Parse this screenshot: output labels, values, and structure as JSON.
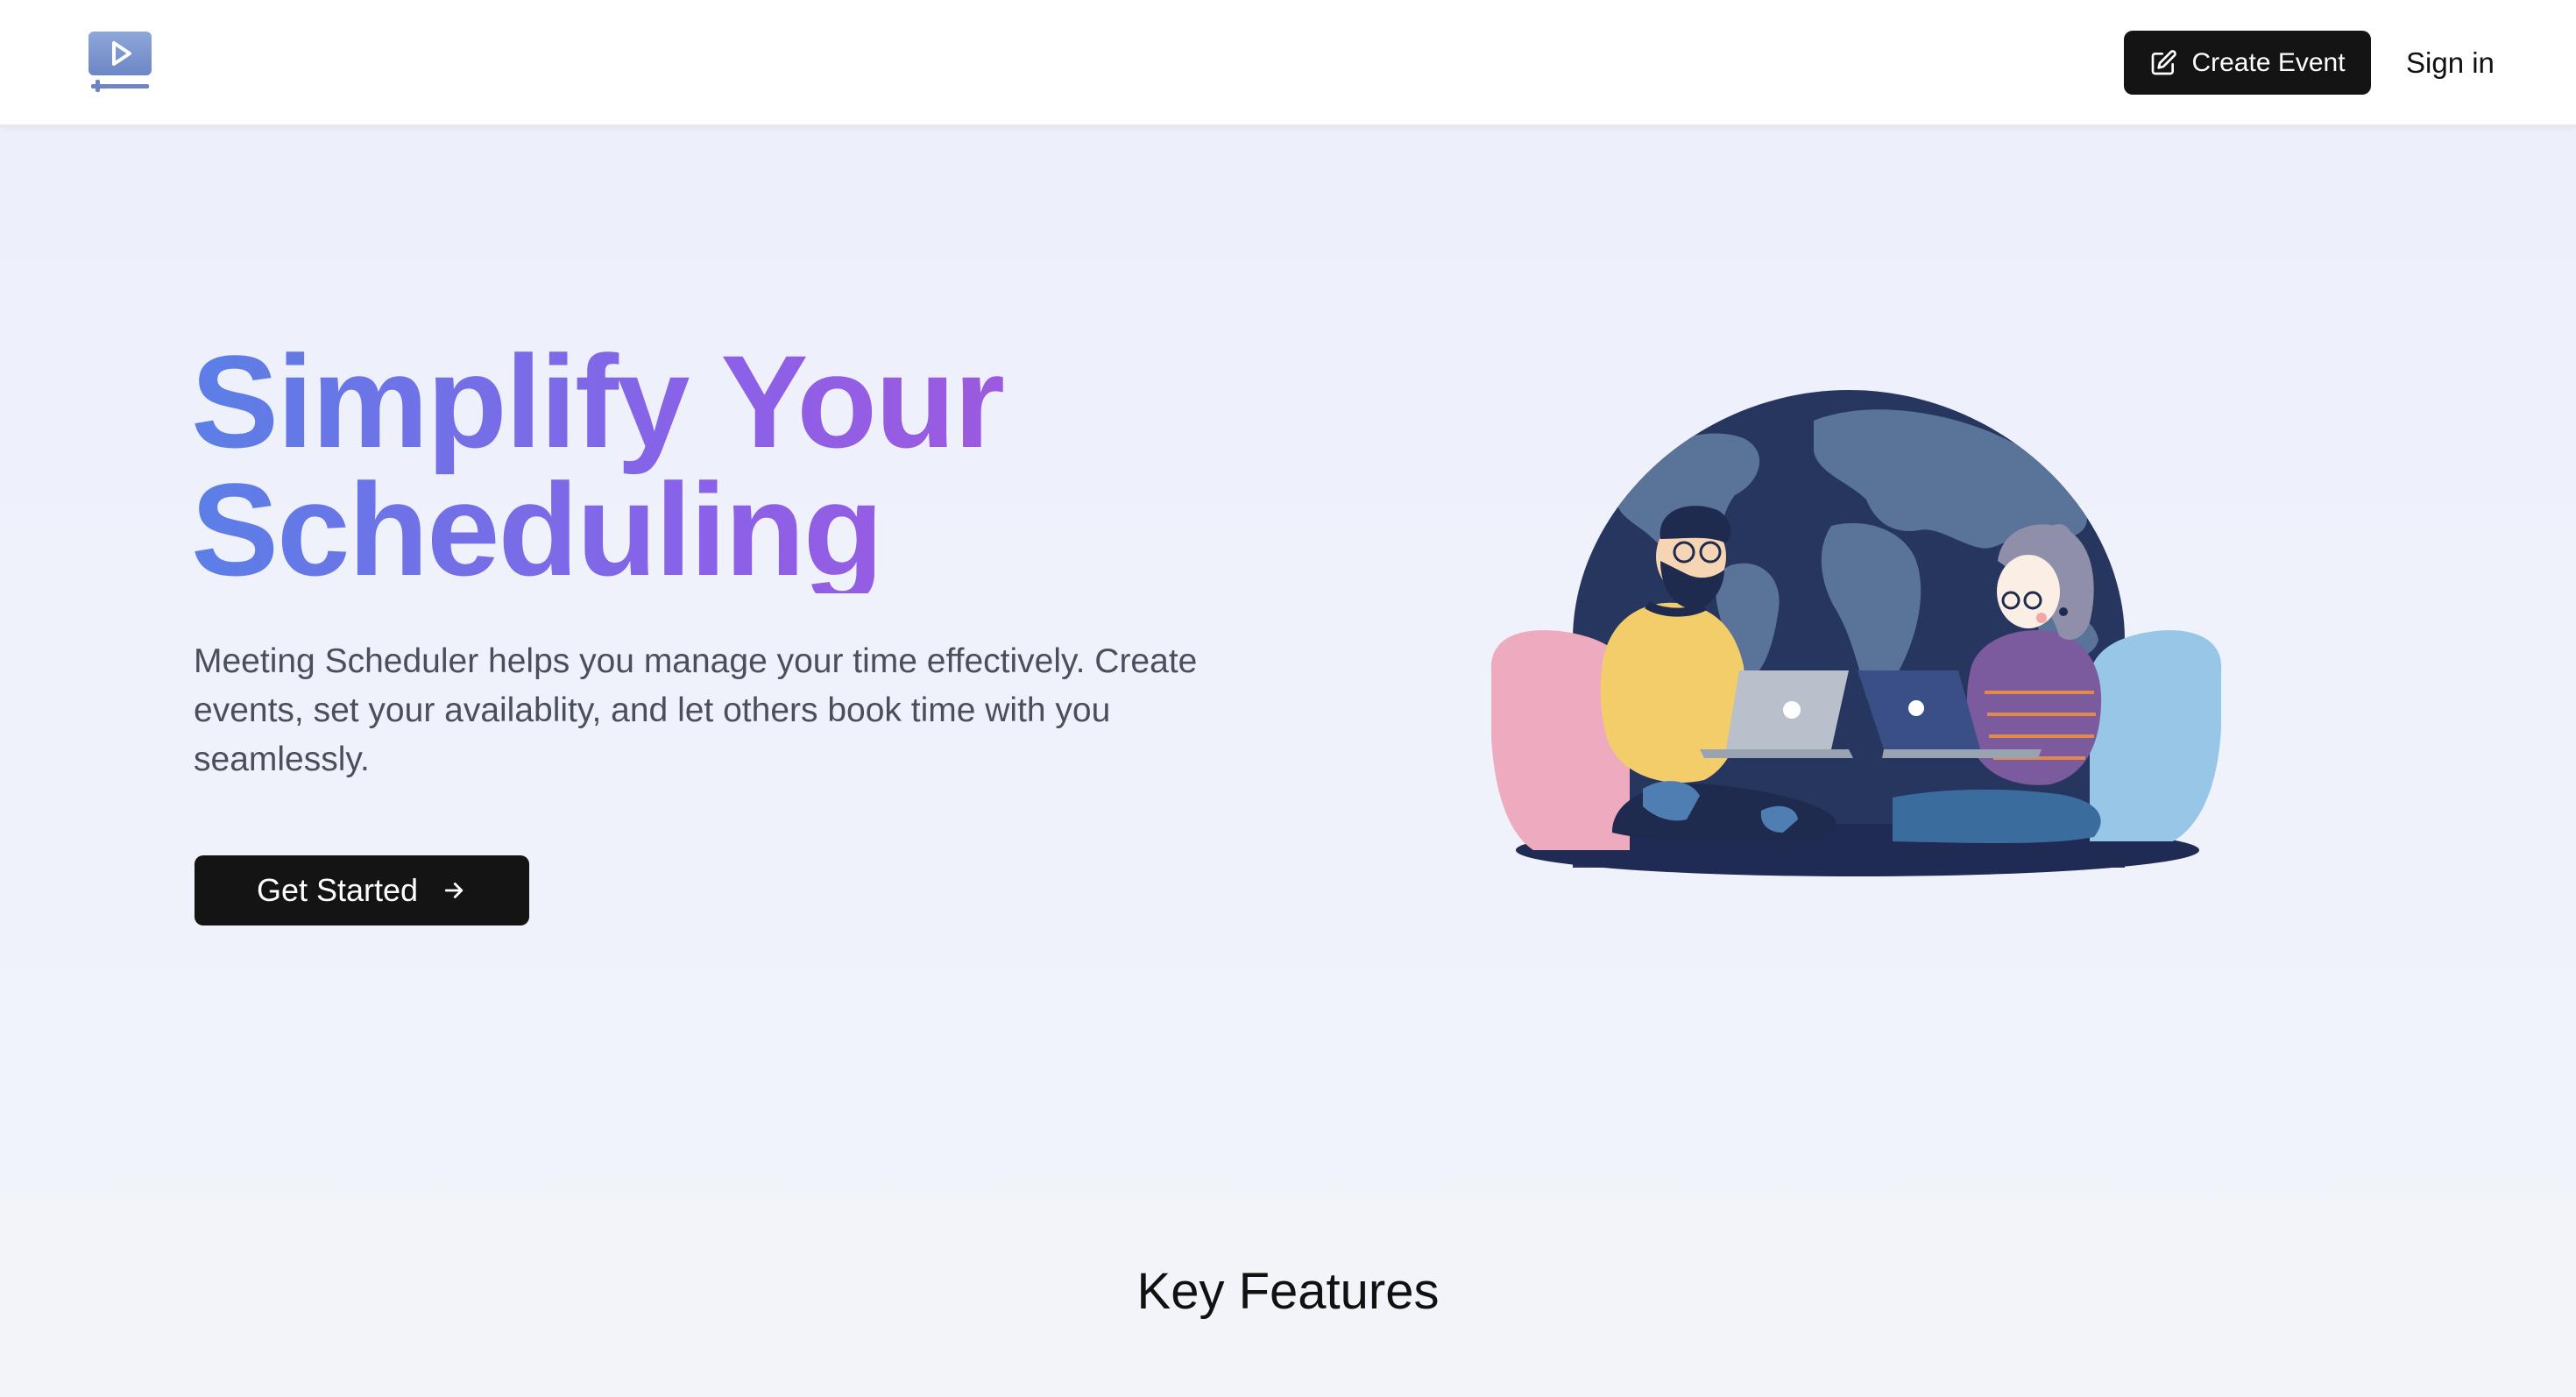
{
  "header": {
    "logo_icon": "video-play-icon",
    "create_event_label": "Create Event",
    "create_event_icon": "edit-icon",
    "sign_in_label": "Sign in"
  },
  "hero": {
    "title_line1": "Simplify Your",
    "title_line2": "Scheduling",
    "description": "Meeting Scheduler helps you manage your time effectively. Create events, set your availablity, and let others book time with you seamlessly.",
    "cta_label": "Get Started",
    "cta_icon": "arrow-right-icon",
    "illustration": "people-with-laptops-globe-illustration"
  },
  "features": {
    "title": "Key Features"
  },
  "colors": {
    "accent_start": "#5b7fe6",
    "accent_end": "#b052d6",
    "button_bg": "#141414",
    "page_bg": "#eef0fb"
  }
}
